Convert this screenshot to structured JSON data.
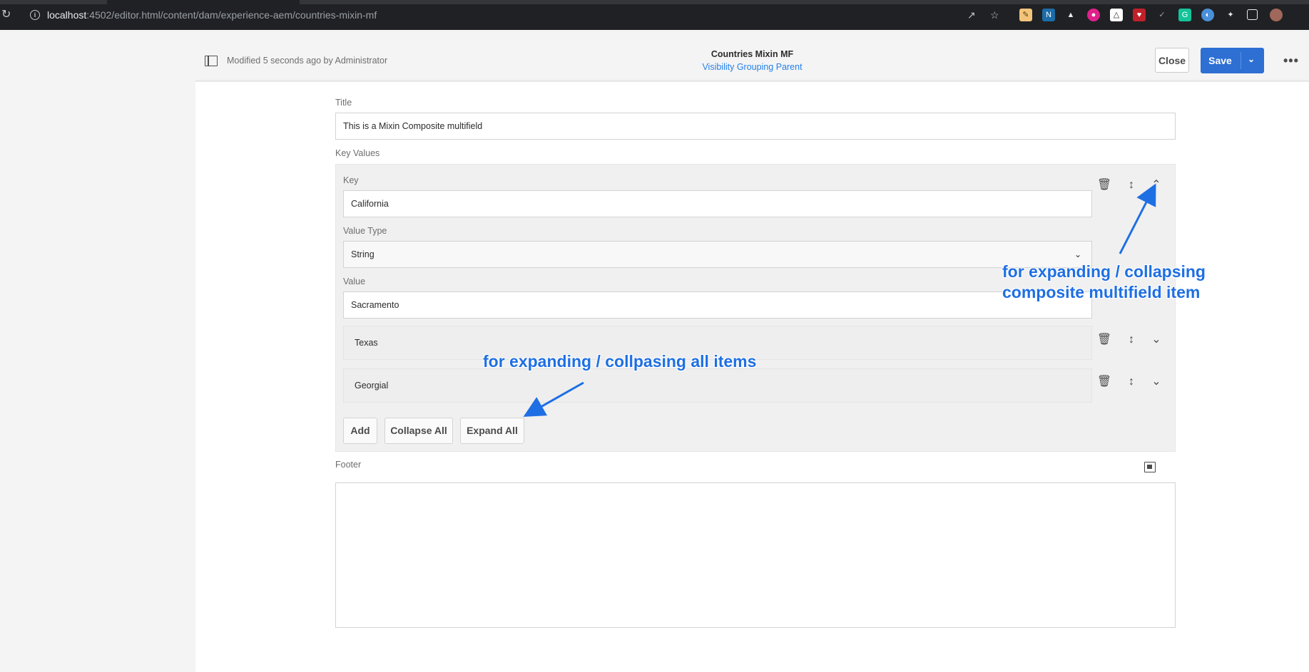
{
  "browser": {
    "url_host": "localhost",
    "url_rest": ":4502/editor.html/content/dam/experience-aem/countries-mixin-mf",
    "extensions": [
      "pen-ext-icon",
      "n-ext-icon",
      "mortarboard-ext-icon",
      "circle-ext-icon",
      "triangle-ext-icon",
      "shield-ext-icon",
      "check-ext-icon",
      "g-ext-icon",
      "globe-ext-icon",
      "puzzle-icon",
      "sidebar-icon",
      "avatar"
    ]
  },
  "header": {
    "modified": "Modified 5 seconds ago by Administrator",
    "title": "Countries Mixin MF",
    "subtitle": "Visibility Grouping Parent",
    "close_label": "Close",
    "save_label": "Save"
  },
  "form": {
    "title_label": "Title",
    "title_value": "This is a Mixin Composite multifield",
    "key_values_label": "Key Values",
    "item": {
      "key_label": "Key",
      "key_value": "California",
      "value_type_label": "Value Type",
      "value_type_value": "String",
      "value_label": "Value",
      "value_value": "Sacramento"
    },
    "collapsed_items": [
      "Texas",
      "Georgial"
    ],
    "add_label": "Add",
    "collapse_all_label": "Collapse All",
    "expand_all_label": "Expand All",
    "footer_label": "Footer"
  },
  "annotations": {
    "item_note_line1": "for expanding / collapsing",
    "item_note_line2": "composite multifield item",
    "all_note": "for expanding / collpasing all items",
    "color": "#1e6fe3"
  },
  "colors": {
    "accent": "#2d6fd3",
    "link": "#2680eb"
  }
}
